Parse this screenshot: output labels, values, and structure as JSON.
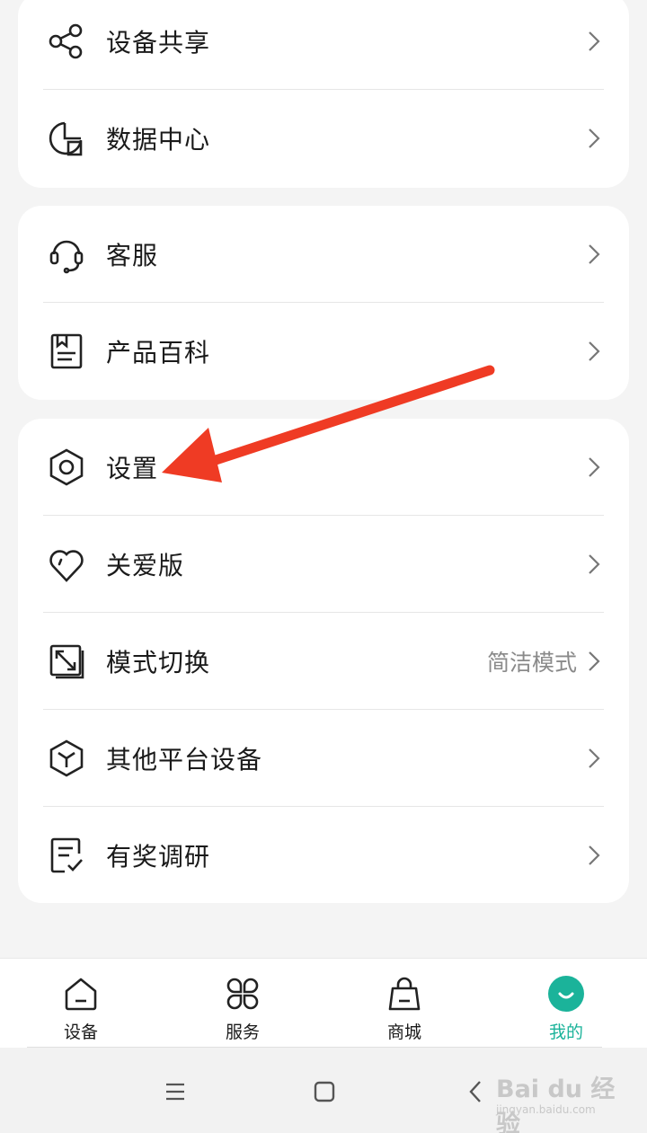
{
  "menu": {
    "group1": [
      {
        "label": "设备共享",
        "icon": "share-icon"
      },
      {
        "label": "数据中心",
        "icon": "data-center-icon"
      }
    ],
    "group2": [
      {
        "label": "客服",
        "icon": "headset-icon"
      },
      {
        "label": "产品百科",
        "icon": "book-icon"
      }
    ],
    "group3": [
      {
        "label": "设置",
        "icon": "hexagon-settings-icon"
      },
      {
        "label": "关爱版",
        "icon": "heart-icon"
      },
      {
        "label": "模式切换",
        "icon": "resize-icon",
        "value": "简洁模式"
      },
      {
        "label": "其他平台设备",
        "icon": "cube-icon"
      },
      {
        "label": "有奖调研",
        "icon": "survey-icon"
      }
    ]
  },
  "tabbar": {
    "tabs": [
      {
        "label": "设备",
        "icon": "home-icon"
      },
      {
        "label": "服务",
        "icon": "clover-icon"
      },
      {
        "label": "商城",
        "icon": "bag-icon"
      },
      {
        "label": "我的",
        "icon": "smile-avatar-icon",
        "active": true
      }
    ],
    "active_color": "#1bb39a"
  },
  "annotation": {
    "arrow_color": "#ef3b24"
  },
  "watermark": {
    "main": "Bai du 经验",
    "sub": "jingyan.baidu.com"
  }
}
